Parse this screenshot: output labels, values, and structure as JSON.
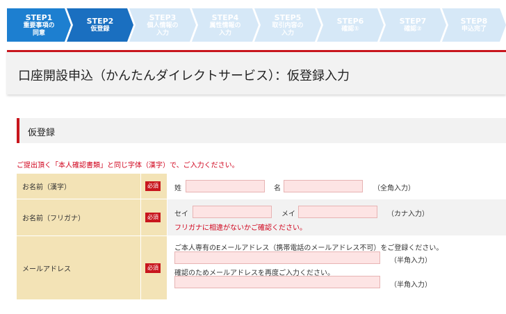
{
  "steps": [
    {
      "num": "STEP1",
      "label1": "重要事項の",
      "label2": "同意"
    },
    {
      "num": "STEP2",
      "label1": "仮登録",
      "label2": ""
    },
    {
      "num": "STEP3",
      "label1": "個人情報の",
      "label2": "入力"
    },
    {
      "num": "STEP4",
      "label1": "属性情報の",
      "label2": "入力"
    },
    {
      "num": "STEP5",
      "label1": "取引内容の",
      "label2": "入力"
    },
    {
      "num": "STEP6",
      "label1": "確認①",
      "label2": ""
    },
    {
      "num": "STEP7",
      "label1": "確認②",
      "label2": ""
    },
    {
      "num": "STEP8",
      "label1": "申込完了",
      "label2": ""
    }
  ],
  "page_title": "口座開設申込（かんたんダイレクトサービス）：仮登録入力",
  "section_title": "仮登録",
  "notice": "ご提出頂く「本人確認書類」と同じ字体（漢字）で、ご入力ください。",
  "required_badge": "必須",
  "form": {
    "name_kanji": {
      "label": "お名前（漢字）",
      "sei_label": "姓",
      "mei_label": "名",
      "note": "（全角入力）",
      "sei_value": "",
      "mei_value": ""
    },
    "name_kana": {
      "label": "お名前（フリガナ）",
      "sei_label": "セイ",
      "mei_label": "メイ",
      "note": "（カナ入力）",
      "warning": "フリガナに相違がないかご確認ください。",
      "sei_value": "",
      "mei_value": ""
    },
    "email": {
      "label": "メールアドレス",
      "instruction": "ご本人専有のEメールアドレス（携帯電話のメールアドレス不可）をご登録ください。",
      "note": "（半角入力）",
      "confirm_instruction": "確認のためメールアドレスを再度ご入力ください。",
      "confirm_note": "（半角入力）",
      "value": "",
      "confirm_value": ""
    }
  }
}
